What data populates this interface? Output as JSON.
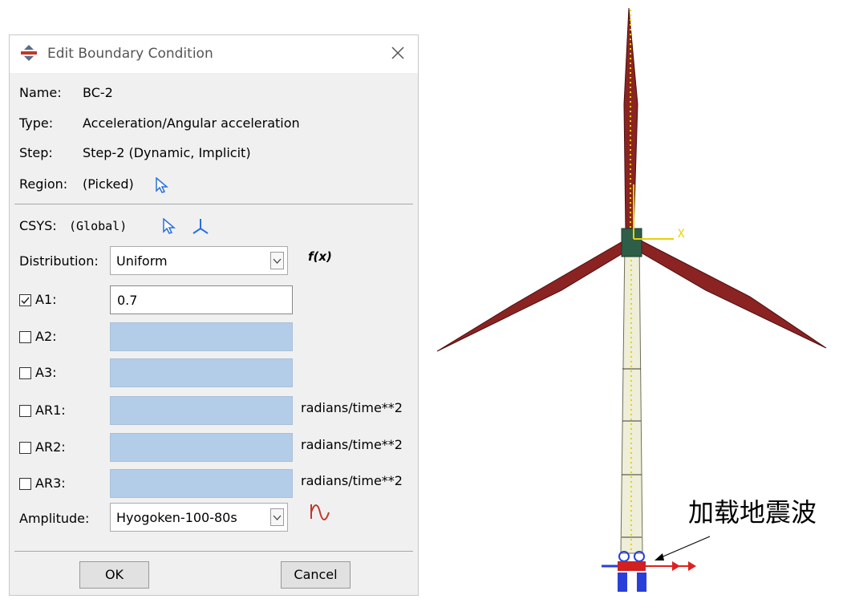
{
  "dialog": {
    "title": "Edit Boundary Condition",
    "name_label": "Name:",
    "name_value": "BC-2",
    "type_label": "Type:",
    "type_value": "Acceleration/Angular acceleration",
    "step_label": "Step:",
    "step_value": "Step-2 (Dynamic, Implicit)",
    "region_label": "Region:",
    "region_value": "(Picked)",
    "csys_label": "CSYS:",
    "csys_value": "(Global)",
    "distribution_label": "Distribution:",
    "distribution_value": "Uniform",
    "fx_label": "f(x)",
    "fields": [
      {
        "label": "A1:",
        "checked": true,
        "value": "0.7",
        "unit": ""
      },
      {
        "label": "A2:",
        "checked": false,
        "value": "",
        "unit": ""
      },
      {
        "label": "A3:",
        "checked": false,
        "value": "",
        "unit": ""
      },
      {
        "label": "AR1:",
        "checked": false,
        "value": "",
        "unit": "radians/time**2"
      },
      {
        "label": "AR2:",
        "checked": false,
        "value": "",
        "unit": "radians/time**2"
      },
      {
        "label": "AR3:",
        "checked": false,
        "value": "",
        "unit": "radians/time**2"
      }
    ],
    "amplitude_label": "Amplitude:",
    "amplitude_value": "Hyogoken-100-80s",
    "ok_label": "OK",
    "cancel_label": "Cancel"
  },
  "viewport": {
    "axis_x_label": "X",
    "annotation": "加载地震波"
  },
  "colors": {
    "blade": "#8b2323",
    "tower": "#efeed8",
    "hub": "#2e5e47",
    "axis": "#e8d200",
    "field_inactive": "#b3cde8",
    "cursor_icon": "#2a6fdc"
  },
  "icons": [
    "boundary-condition-icon",
    "close-icon",
    "select-arrow-icon",
    "csys-axis-icon",
    "checkbox-check-icon",
    "amplitude-icon",
    "chevron-down-icon"
  ]
}
